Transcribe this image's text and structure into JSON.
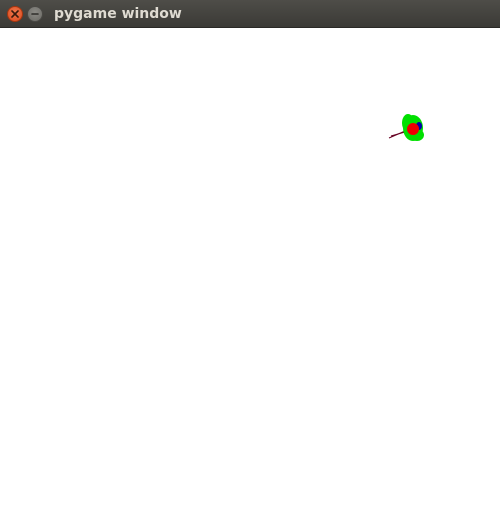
{
  "window": {
    "title": "pygame window",
    "controls": {
      "close_icon": "close-icon",
      "minimize_icon": "minimize-icon"
    }
  },
  "scene": {
    "background_color": "#ffffff",
    "sprite": {
      "body_color": "#00e000",
      "core_color": "#ee0000",
      "marker_color": "#0000aa",
      "line_color": "#660022"
    }
  }
}
